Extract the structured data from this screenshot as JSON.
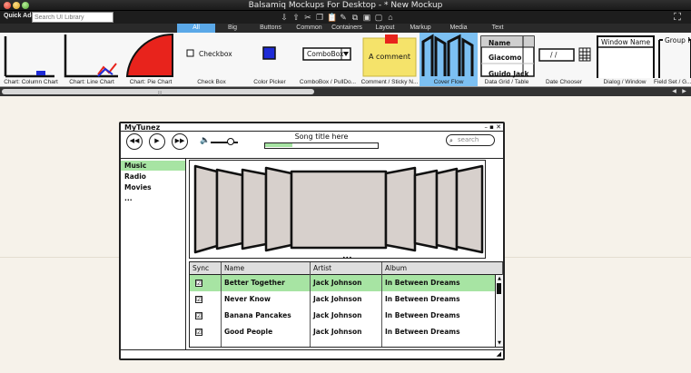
{
  "window": {
    "title": "Balsamiq Mockups For Desktop - * New Mockup"
  },
  "toolbar": {
    "quick_add_label": "Quick Add:",
    "quick_add_placeholder": "Search UI Library",
    "tools": [
      "import-icon",
      "export-icon",
      "cut-icon",
      "copy-icon",
      "paste-icon",
      "edit-icon",
      "duplicate-icon",
      "group-icon",
      "ungroup-icon",
      "lock-icon",
      "fullscreen-icon"
    ]
  },
  "category_tabs": [
    {
      "label": "All",
      "active": true
    },
    {
      "label": "Big",
      "active": false
    },
    {
      "label": "Buttons",
      "active": false
    },
    {
      "label": "Common",
      "active": false
    },
    {
      "label": "Containers",
      "active": false
    },
    {
      "label": "Layout",
      "active": false
    },
    {
      "label": "Markup",
      "active": false
    },
    {
      "label": "Media",
      "active": false
    },
    {
      "label": "Text",
      "active": false
    }
  ],
  "library": {
    "items": [
      {
        "label": "Chart: Column Chart",
        "icon": "column-chart-icon"
      },
      {
        "label": "Chart: Line Chart",
        "icon": "line-chart-icon"
      },
      {
        "label": "Chart: Pie Chart",
        "icon": "pie-chart-icon"
      },
      {
        "label": "Check Box",
        "icon": "checkbox-icon",
        "text": "Checkbox"
      },
      {
        "label": "Color Picker",
        "icon": "color-picker-icon"
      },
      {
        "label": "ComboBox / PullDo...",
        "icon": "combobox-icon",
        "text": "ComboBox"
      },
      {
        "label": "Comment / Sticky N...",
        "icon": "sticky-note-icon",
        "text": "A comment"
      },
      {
        "label": "Cover Flow",
        "icon": "cover-flow-icon",
        "selected": true
      },
      {
        "label": "Data Grid / Table",
        "icon": "data-grid-icon",
        "text_rows": [
          "Name",
          "Giacomo",
          "Guido Jack"
        ]
      },
      {
        "label": "Date Chooser",
        "icon": "date-chooser-icon",
        "text": "/ /"
      },
      {
        "label": "Dialog / Window",
        "icon": "dialog-icon",
        "text": "Window Name"
      },
      {
        "label": "Field Set / G...",
        "icon": "field-set-icon",
        "text": "Group N"
      }
    ],
    "colors": {
      "selected": "#7cc0f2",
      "accent_red": "#e8231c",
      "accent_blue": "#1e2bd6",
      "sticky": "#f5e36a"
    }
  },
  "mockup": {
    "title": "MyTunez",
    "controls": {
      "rewind": "rewind-icon",
      "play": "play-icon",
      "fast_forward": "fast-forward-icon",
      "volume": "volume-icon"
    },
    "song_title": "Song title here",
    "progress": 0.5,
    "search_placeholder": "search",
    "sidebar": {
      "items": [
        {
          "label": "Music",
          "selected": true
        },
        {
          "label": "Radio",
          "selected": false
        },
        {
          "label": "Movies",
          "selected": false
        },
        {
          "label": "...",
          "selected": false
        }
      ]
    },
    "grid": {
      "columns": [
        "Sync",
        "Name",
        "Artist",
        "Album"
      ],
      "rows": [
        {
          "sync": true,
          "name": "Better Together",
          "artist": "Jack Johnson",
          "album": "In Between Dreams",
          "selected": true
        },
        {
          "sync": true,
          "name": "Never Know",
          "artist": "Jack Johnson",
          "album": "In Between Dreams",
          "selected": false
        },
        {
          "sync": true,
          "name": "Banana Pancakes",
          "artist": "Jack Johnson",
          "album": "In Between Dreams",
          "selected": false
        },
        {
          "sync": true,
          "name": "Good People",
          "artist": "Jack Johnson",
          "album": "In Between Dreams",
          "selected": false
        }
      ],
      "check_glyph": "☑"
    },
    "colors": {
      "selection": "#a7e4a3",
      "cover": "#d7d0cc"
    }
  }
}
